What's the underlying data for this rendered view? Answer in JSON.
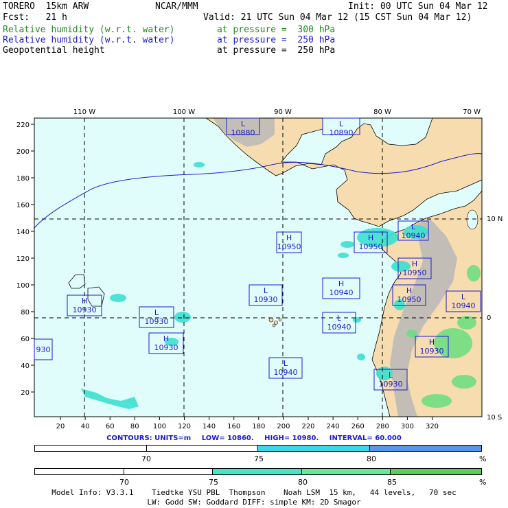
{
  "header": {
    "model": "TORERO  15km ARW",
    "center": "NCAR/MMM",
    "init": "Init: 00 UTC Sun 04 Mar 12",
    "fcst": "Fcst:   21 h",
    "valid": "Valid: 21 UTC Sun 04 Mar 12 (15 CST Sun 04 Mar 12)",
    "fields": [
      {
        "name": "Relative humidity (w.r.t. water)",
        "level": "at pressure =  300 hPa",
        "color": "#1e8b1e"
      },
      {
        "name": "Relative humidity (w.r.t. water)",
        "level": "at pressure =  250 hPa",
        "color": "#1a1ad0"
      },
      {
        "name": "Geopotential height",
        "level": "at pressure =  250 hPa",
        "color": "#000000"
      }
    ]
  },
  "map": {
    "lon_labels": [
      "110 W",
      "100 W",
      "90 W",
      "80 W",
      "70 W"
    ],
    "lat_labels": [
      "10 N",
      "0",
      "10 S"
    ],
    "y_ticks": [
      "220",
      "200",
      "180",
      "160",
      "140",
      "120",
      "100",
      "80",
      "60",
      "40",
      "20"
    ],
    "x_ticks": [
      "20",
      "40",
      "60",
      "80",
      "100",
      "120",
      "140",
      "160",
      "180",
      "200",
      "220",
      "240",
      "260",
      "280",
      "300",
      "320"
    ],
    "colors": {
      "ocean": "#e0fdfc",
      "land": "#f6dcae",
      "terrain": "#b8b8b8",
      "rh_cyan": "#3ce0d0",
      "rh_green": "#6adf80"
    },
    "centers": [
      {
        "type": "L",
        "value": "10880"
      },
      {
        "type": "L",
        "value": "10890"
      },
      {
        "type": "H",
        "value": "10950"
      },
      {
        "type": "H",
        "value": "10950"
      },
      {
        "type": "L",
        "value": "10930"
      },
      {
        "type": "H",
        "value": "10950"
      },
      {
        "type": "H",
        "value": "10930"
      },
      {
        "type": "L",
        "value": "10930"
      },
      {
        "type": "H",
        "value": "10940"
      },
      {
        "type": "H",
        "value": "10950"
      },
      {
        "type": "L",
        "value": "10940"
      },
      {
        "type": "H",
        "value": "10930"
      },
      {
        "type": "L",
        "value": "10940"
      },
      {
        "type": "H",
        "value": "10930"
      },
      {
        "type": "L",
        "value": "10930"
      },
      {
        "type": "L",
        "value": "10940"
      },
      {
        "type": "L",
        "value": "10940"
      },
      {
        "type": "",
        "value": "930"
      }
    ]
  },
  "contours": {
    "units": "CONTOURS:  UNITS=m",
    "low": "LOW=  10860.",
    "high": "HIGH=  10980.",
    "interval": "INTERVAL=   60.000"
  },
  "colorbar1": {
    "labels": [
      "70",
      "75",
      "80",
      "%"
    ],
    "segments": [
      {
        "color": "#ffffff"
      },
      {
        "color": "#ffffff"
      },
      {
        "color": "#3cd8e8"
      },
      {
        "color": "#5a96e8"
      }
    ]
  },
  "colorbar2": {
    "labels": [
      "70",
      "75",
      "80",
      "85",
      "%"
    ],
    "segments": [
      {
        "color": "#ffffff"
      },
      {
        "color": "#ffffff"
      },
      {
        "color": "#44e6c8"
      },
      {
        "color": "#6ae69a"
      },
      {
        "color": "#5ccc5c"
      }
    ]
  },
  "footer": {
    "line1": "Model Info: V3.3.1    Tiedtke YSU PBL  Thompson    Noah LSM  15 km,   44 levels,   70 sec",
    "line2": "LW: Godd SW: Goddard DIFF: simple KM: 2D Smagor"
  }
}
